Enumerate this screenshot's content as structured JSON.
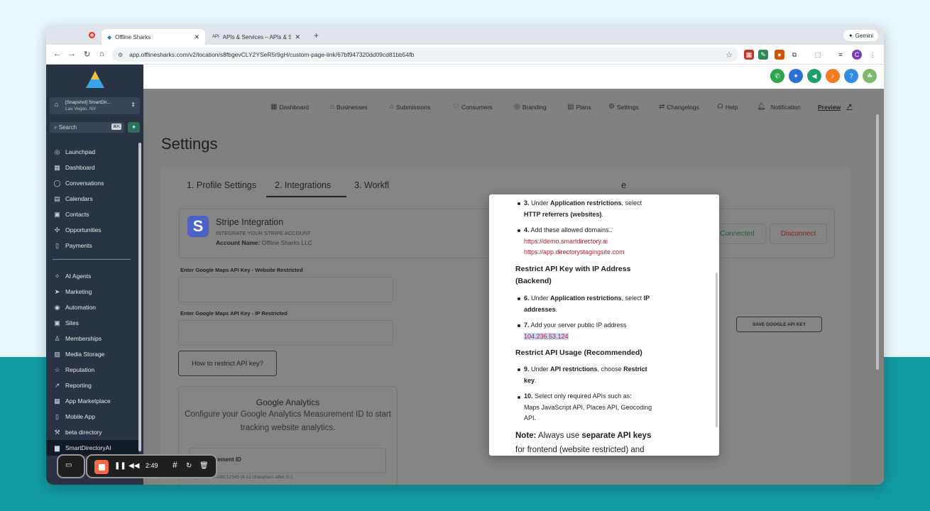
{
  "browser": {
    "tabs": [
      {
        "title": "Offline Sharks",
        "icon": "diamond-logo-icon"
      },
      {
        "title": "APIs & Services – APIs & Ser",
        "icon": "api-icon"
      }
    ],
    "gemini_label": "Gemini",
    "url": "app.offlinesharks.com/v2/location/s8fbgevCLY2YSeR5r9gH/custom-page-link/67bf947320dd09cd81bb54fb"
  },
  "sidebar": {
    "account_name": "[Snapshot] SmartDir...",
    "account_location": "Las Vegas, NV",
    "search_placeholder": "Search",
    "search_kbd": "⌘K",
    "items_top": [
      {
        "label": "Launchpad",
        "icon": "launchpad-icon"
      },
      {
        "label": "Dashboard",
        "icon": "dashboard-icon"
      },
      {
        "label": "Conversations",
        "icon": "chat-icon"
      },
      {
        "label": "Calendars",
        "icon": "calendar-icon"
      },
      {
        "label": "Contacts",
        "icon": "contacts-icon"
      },
      {
        "label": "Opportunities",
        "icon": "opportunities-icon"
      },
      {
        "label": "Payments",
        "icon": "payments-icon"
      }
    ],
    "items_bottom": [
      {
        "label": "AI Agents",
        "icon": "sparkle-icon"
      },
      {
        "label": "Marketing",
        "icon": "send-icon"
      },
      {
        "label": "Automation",
        "icon": "automation-icon"
      },
      {
        "label": "Sites",
        "icon": "sites-icon"
      },
      {
        "label": "Memberships",
        "icon": "membership-icon"
      },
      {
        "label": "Media Storage",
        "icon": "media-icon"
      },
      {
        "label": "Reputation",
        "icon": "star-icon"
      },
      {
        "label": "Reporting",
        "icon": "chart-icon"
      },
      {
        "label": "App Marketplace",
        "icon": "grid-icon"
      },
      {
        "label": "Mobile App",
        "icon": "mobile-icon"
      },
      {
        "label": "beta directory",
        "icon": "wrench-icon"
      },
      {
        "label": "SmartDirectoryAI",
        "icon": "book-icon"
      }
    ]
  },
  "topnav": [
    {
      "label": "Dashboard",
      "icon": "dashboard-icon"
    },
    {
      "label": "Businesses",
      "icon": "business-icon"
    },
    {
      "label": "Submissions",
      "icon": "submissions-icon"
    },
    {
      "label": "Consumers",
      "icon": "heart-icon"
    },
    {
      "label": "Branding",
      "icon": "branding-icon"
    },
    {
      "label": "Plans",
      "icon": "plans-icon"
    },
    {
      "label": "Settings",
      "icon": "gear-icon"
    },
    {
      "label": "Changelogs",
      "icon": "swap-icon"
    },
    {
      "label": "Help",
      "icon": "help-icon"
    },
    {
      "label": "Notification",
      "icon": "bell-icon"
    },
    {
      "label": "Preview",
      "icon": "external-link-icon"
    }
  ],
  "page_title": "Settings",
  "settings_tabs": [
    "1. Profile Settings",
    "2. Integrations",
    "3. Workfl",
    "e"
  ],
  "stripe": {
    "logo_letter": "S",
    "title": "Stripe Integration",
    "subtitle": "INTEGRATE YOUR STRIPE ACCOUNT",
    "account_label": "Account Name:",
    "account_value": "Offline Sharks LLC",
    "connected_label": "Connected",
    "disconnect_label": "Disconnect"
  },
  "google_maps": {
    "website_label": "Enter Google Maps API Key - Website Restricted",
    "ip_label": "Enter Google Maps API Key - IP Restricted",
    "save_label": "SAVE GOOGLE API KEY",
    "how_label": "How to restrict API key?"
  },
  "google_analytics": {
    "title": "Google Analytics",
    "description": "Configure your Google Analytics Measurement ID to start tracking website analytics.",
    "field_label": "rement ID",
    "hint": "(format: G-ABC12345 (8-12 characters after G-)"
  },
  "modal": {
    "s3_num": "3.",
    "s3_a": " Under ",
    "s3_b": "Application restrictions",
    "s3_c": ", select",
    "s3_d": "HTTP referrers (websites)",
    "s3_e": ".",
    "s4_num": "4.",
    "s4_text": " Add these allowed domains..",
    "domain1": "https://demo.smartdirectory.ai",
    "domain2": "https://app.directorystagingsite.com",
    "heading_ip_1": "Restrict API Key with IP Address",
    "heading_ip_2": "(Backend)",
    "s6_num": "6.",
    "s6_a": " Under ",
    "s6_b": "Application restrictions",
    "s6_c": ", select ",
    "s6_d": "IP",
    "s6_e": "addresses",
    "s6_f": ".",
    "s7_num": "7.",
    "s7_text": " Add your server public IP address",
    "ip": "104.236.53.124",
    "heading_usage": "Restrict API Usage (Recommended)",
    "s9_num": "9.",
    "s9_a": " Under ",
    "s9_b": "API restrictions",
    "s9_c": ", choose ",
    "s9_d": "Restrict",
    "s9_e": "key",
    "s9_f": ".",
    "s10_num": "10.",
    "s10_text": " Select only required APIs such as:",
    "s10_apis_1": "Maps JavaScript API, Places API, Geocoding",
    "s10_apis_2": "API.",
    "note_label": "Note:",
    "note_a": " Always use ",
    "note_b": "separate API keys",
    "note_c": "for frontend (website restricted) and"
  },
  "recorder": {
    "time": "2:49"
  },
  "colors": {
    "sidebar_bg": "#2a3344",
    "stripe_blue": "#4b62c6",
    "link_red": "#b8202a",
    "record_orange": "#f06a4a",
    "teal_bg": "#129ba3"
  }
}
